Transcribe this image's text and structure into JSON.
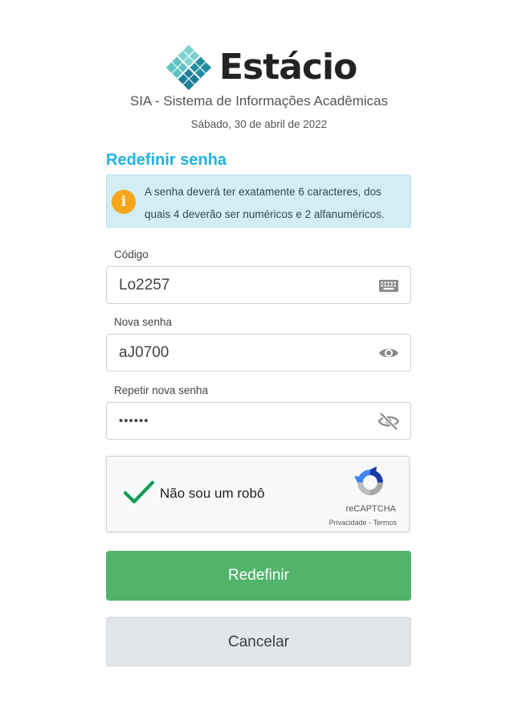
{
  "header": {
    "brand": "Estácio",
    "system_name": "SIA - Sistema de Informações Acadêmicas",
    "date": "Sábado, 30 de abril de 2022"
  },
  "form": {
    "title": "Redefinir senha",
    "alert": {
      "icon": "info-icon",
      "text": "A senha deverá ter exatamente 6 caracteres, dos quais 4 deverão ser numéricos e 2 alfanuméricos."
    },
    "fields": [
      {
        "label": "Código",
        "value": "Lo2257",
        "icon": "keyboard-icon"
      },
      {
        "label": "Nova senha",
        "value": "aJ0700",
        "icon": "eye-icon"
      },
      {
        "label": "Repetir nova senha",
        "value": "••••••",
        "icon": "eye-slash-icon"
      }
    ],
    "captcha": {
      "label": "Não sou um robô",
      "brand": "reCAPTCHA",
      "privacy": "Privacidade",
      "separator": " - ",
      "terms": "Termos",
      "checked": true
    },
    "submit_label": "Redefinir",
    "cancel_label": "Cancelar"
  },
  "colors": {
    "accent": "#1eb4e0",
    "primary_button": "#52b36a",
    "secondary_button": "#e2e5ea",
    "alert_bg": "#d3eef3",
    "alert_icon": "#f7a61b",
    "check": "#109e5a"
  }
}
